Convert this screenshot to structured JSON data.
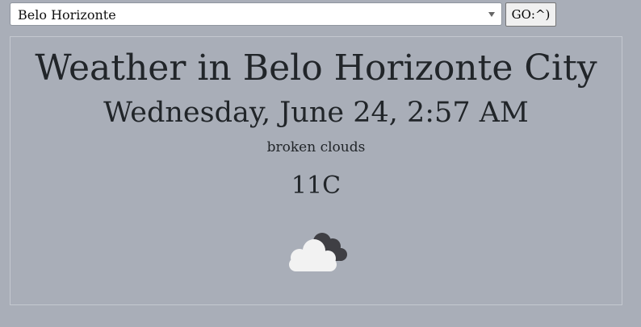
{
  "search": {
    "selected_city": "Belo Horizonte",
    "go_label": "GO:^)"
  },
  "weather": {
    "title": "Weather in Belo Horizonte City",
    "datetime": "Wednesday, June 24, 2:57 AM",
    "description": "broken clouds",
    "temperature": "11C",
    "icon": "broken-clouds-icon"
  },
  "colors": {
    "background": "#a9aeb8",
    "text": "#212529",
    "cloud_light": "#f2f2f2",
    "cloud_dark": "#3f3f44"
  }
}
